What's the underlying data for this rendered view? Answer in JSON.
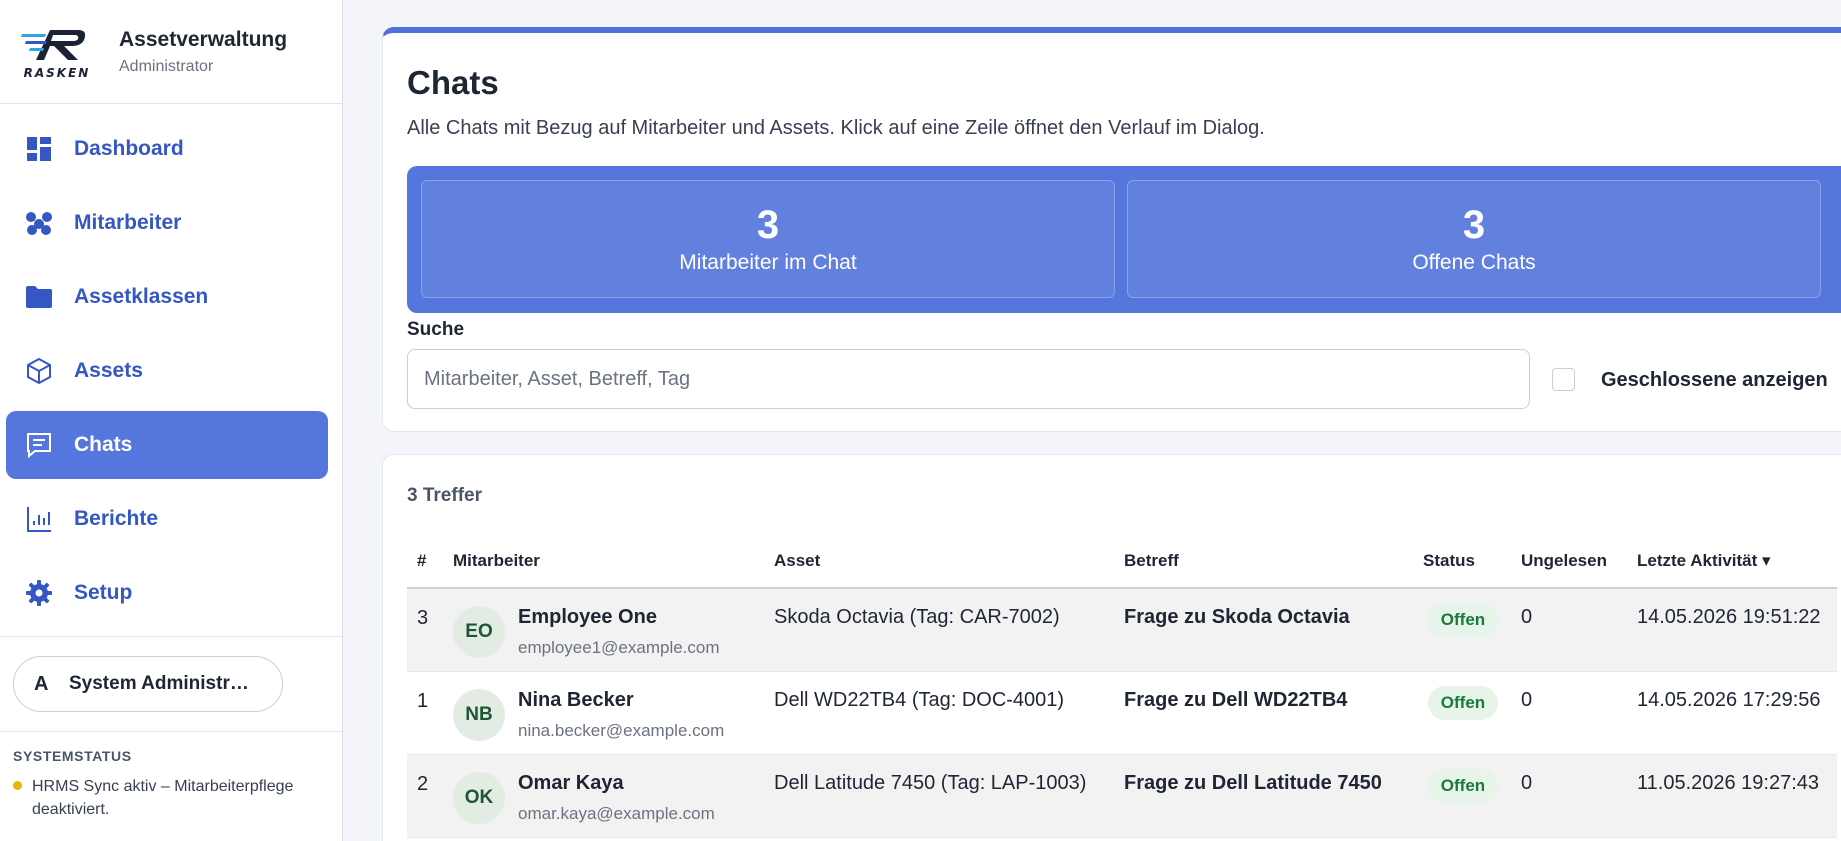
{
  "brand": {
    "logo_text": "RASKEN",
    "title": "Assetverwaltung",
    "subtitle": "Administrator"
  },
  "sidebar": {
    "items": [
      {
        "label": "Dashboard",
        "icon": "dashboard-icon"
      },
      {
        "label": "Mitarbeiter",
        "icon": "people-icon"
      },
      {
        "label": "Assetklassen",
        "icon": "folder-icon"
      },
      {
        "label": "Assets",
        "icon": "cube-icon"
      },
      {
        "label": "Chats",
        "icon": "chat-icon",
        "active": true
      },
      {
        "label": "Berichte",
        "icon": "bar-chart-icon"
      },
      {
        "label": "Setup",
        "icon": "gear-icon"
      }
    ],
    "user": {
      "initial": "A",
      "name": "System Administr…"
    },
    "system_status": {
      "heading": "SYSTEMSTATUS",
      "text": "HRMS Sync aktiv – Mitarbeiterpflege deaktiviert.",
      "dot_color": "#eab308"
    }
  },
  "colors": {
    "accent": "#5577dd",
    "accent_dark": "#3457c4",
    "status_ok_bg": "#e6f4ea",
    "status_ok_text": "#1b7a3b"
  },
  "page": {
    "title": "Chats",
    "subtitle": "Alle Chats mit Bezug auf Mitarbeiter und Assets. Klick auf eine Zeile öffnet den Verlauf im Dialog."
  },
  "stats": [
    {
      "value": "3",
      "label": "Mitarbeiter im Chat"
    },
    {
      "value": "3",
      "label": "Offene Chats"
    }
  ],
  "search": {
    "label": "Suche",
    "placeholder": "Mitarbeiter, Asset, Betreff, Tag",
    "value": "",
    "show_closed_label": "Geschlossene anzeigen",
    "show_closed_checked": false
  },
  "results": {
    "count_text": "3 Treffer",
    "columns": [
      "#",
      "Mitarbeiter",
      "Asset",
      "Betreff",
      "Status",
      "Ungelesen",
      "Letzte Aktivität ▾"
    ],
    "rows": [
      {
        "id": "3",
        "initials": "EO",
        "name": "Employee One",
        "email": "employee1@example.com",
        "asset": "Skoda Octavia (Tag: CAR-7002)",
        "subject": "Frage zu Skoda Octavia",
        "status": "Offen",
        "unread": "0",
        "last_activity": "14.05.2026 19:51:22"
      },
      {
        "id": "1",
        "initials": "NB",
        "name": "Nina Becker",
        "email": "nina.becker@example.com",
        "asset": "Dell WD22TB4 (Tag: DOC-4001)",
        "subject": "Frage zu Dell WD22TB4",
        "status": "Offen",
        "unread": "0",
        "last_activity": "14.05.2026 17:29:56"
      },
      {
        "id": "2",
        "initials": "OK",
        "name": "Omar Kaya",
        "email": "omar.kaya@example.com",
        "asset": "Dell Latitude 7450 (Tag: LAP-1003)",
        "subject": "Frage zu Dell Latitude 7450",
        "status": "Offen",
        "unread": "0",
        "last_activity": "11.05.2026 19:27:43"
      }
    ]
  }
}
